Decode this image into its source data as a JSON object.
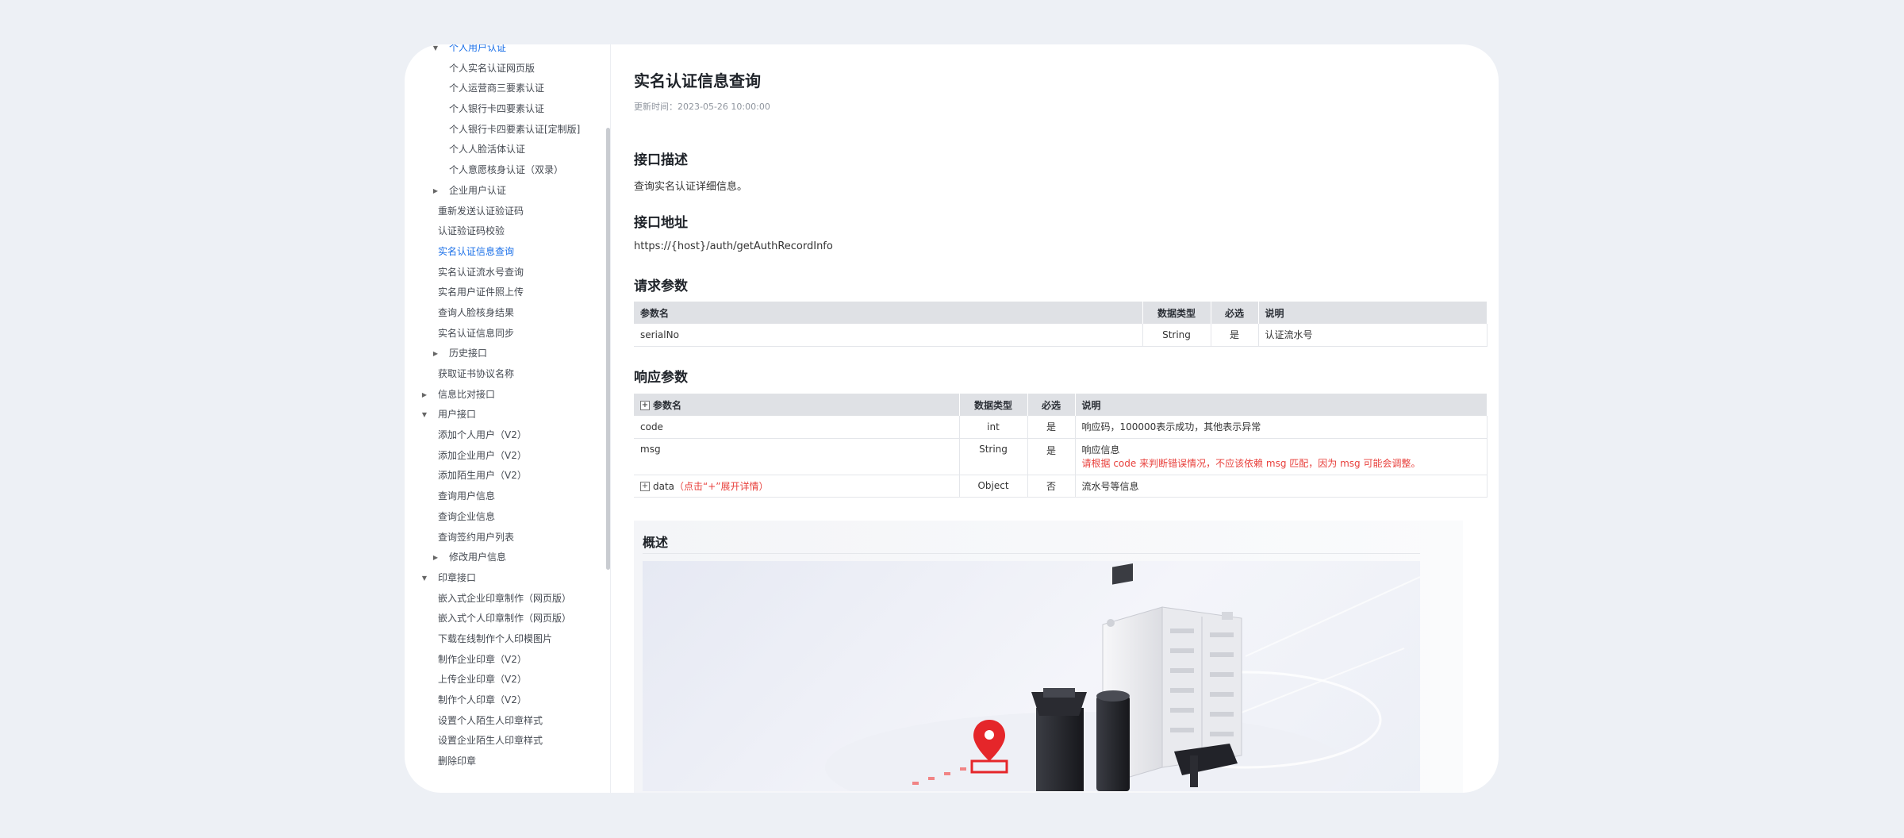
{
  "sidebar": {
    "items": [
      {
        "label": "个人用户认证",
        "indent": 2,
        "toggle": "▼",
        "active": true
      },
      {
        "label": "个人实名认证网页版",
        "indent": 3
      },
      {
        "label": "个人运营商三要素认证",
        "indent": 3
      },
      {
        "label": "个人银行卡四要素认证",
        "indent": 3
      },
      {
        "label": "个人银行卡四要素认证[定制版]",
        "indent": 3
      },
      {
        "label": "个人人脸活体认证",
        "indent": 3
      },
      {
        "label": "个人意愿核身认证（双录）",
        "indent": 3
      },
      {
        "label": "企业用户认证",
        "indent": 2,
        "toggle": "▶"
      },
      {
        "label": "重新发送认证验证码",
        "indent": 1
      },
      {
        "label": "认证验证码校验",
        "indent": 1
      },
      {
        "label": "实名认证信息查询",
        "indent": 1,
        "active": true
      },
      {
        "label": "实名认证流水号查询",
        "indent": 1
      },
      {
        "label": "实名用户证件照上传",
        "indent": 1
      },
      {
        "label": "查询人脸核身结果",
        "indent": 1
      },
      {
        "label": "实名认证信息同步",
        "indent": 1
      },
      {
        "label": "历史接口",
        "indent": 2,
        "toggle": "▶"
      },
      {
        "label": "获取证书协议名称",
        "indent": 1
      },
      {
        "label": "信息比对接口",
        "indent": 0,
        "toggle": "▶"
      },
      {
        "label": "用户接口",
        "indent": 0,
        "toggle": "▼"
      },
      {
        "label": "添加个人用户（V2）",
        "indent": 1
      },
      {
        "label": "添加企业用户（V2）",
        "indent": 1
      },
      {
        "label": "添加陌生用户（V2）",
        "indent": 1
      },
      {
        "label": "查询用户信息",
        "indent": 1
      },
      {
        "label": "查询企业信息",
        "indent": 1
      },
      {
        "label": "查询签约用户列表",
        "indent": 1
      },
      {
        "label": "修改用户信息",
        "indent": 2,
        "toggle": "▶"
      },
      {
        "label": "印章接口",
        "indent": 0,
        "toggle": "▼"
      },
      {
        "label": "嵌入式企业印章制作（网页版）",
        "indent": 1
      },
      {
        "label": "嵌入式个人印章制作（网页版）",
        "indent": 1
      },
      {
        "label": "下载在线制作个人印模图片",
        "indent": 1
      },
      {
        "label": "制作企业印章（V2）",
        "indent": 1
      },
      {
        "label": "上传企业印章（V2）",
        "indent": 1
      },
      {
        "label": "制作个人印章（V2）",
        "indent": 1
      },
      {
        "label": "设置个人陌生人印章样式",
        "indent": 1
      },
      {
        "label": "设置企业陌生人印章样式",
        "indent": 1
      },
      {
        "label": "删除印章",
        "indent": 1
      }
    ]
  },
  "main": {
    "title": "实名认证信息查询",
    "update_time": "更新时间：2023-05-26 10:00:00",
    "desc_heading": "接口描述",
    "desc_text": "查询实名认证详细信息。",
    "url_heading": "接口地址",
    "url_text": "https://{host}/auth/getAuthRecordInfo",
    "request_heading": "请求参数",
    "request_table": {
      "headers": [
        "参数名",
        "数据类型",
        "必选",
        "说明"
      ],
      "rows": [
        [
          "serialNo",
          "String",
          "是",
          "认证流水号"
        ]
      ]
    },
    "response_heading": "响应参数",
    "response_table": {
      "headers": [
        "参数名",
        "数据类型",
        "必选",
        "说明"
      ],
      "expand_symbol": "+",
      "rows": [
        {
          "name": "code",
          "type": "int",
          "required": "是",
          "desc": "响应码，100000表示成功，其他表示异常"
        },
        {
          "name": "msg",
          "type": "String",
          "required": "是",
          "desc": "响应信息",
          "warning": "请根据 code 来判断错误情况，不应该依赖 msg 匹配，因为 msg 可能会调整。"
        },
        {
          "name": "data",
          "hint": "（点击“+”展开详情）",
          "type": "Object",
          "required": "否",
          "desc": "流水号等信息"
        }
      ]
    },
    "overview_heading": "概述"
  },
  "colors": {
    "accent": "#1a6fe8",
    "warning": "#e8403c",
    "table_header": "#dfe1e5",
    "page_bg": "#edf0f5"
  },
  "illustration": {
    "pin": "location-pin-icon",
    "devices": "smart-terminal-devices-illustration"
  }
}
